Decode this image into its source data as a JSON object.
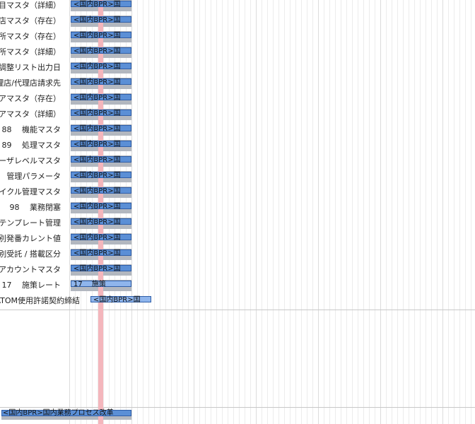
{
  "rows": [
    {
      "label": "目マスタ（詳細）",
      "bar": "<国内BPR>国"
    },
    {
      "label": "店マスタ（存在）",
      "bar": "<国内BPR>国"
    },
    {
      "label": "所マスタ（存在）",
      "bar": "<国内BPR>国"
    },
    {
      "label": "所マスタ（詳細）",
      "bar": "<国内BPR>国"
    },
    {
      "label": "調整リスト出力日",
      "bar": "<国内BPR>国"
    },
    {
      "label": "理店/代理店請求先",
      "bar": "<国内BPR>国"
    },
    {
      "label": "アマスタ（存在）",
      "bar": "<国内BPR>国"
    },
    {
      "label": "アマスタ（詳細）",
      "bar": "<国内BPR>国"
    },
    {
      "label": "88　 機能マスタ",
      "bar": "<国内BPR>国"
    },
    {
      "label": "89　 処理マスタ",
      "bar": "<国内BPR>国"
    },
    {
      "label": "ーザレベルマスタ",
      "bar": "<国内BPR>国"
    },
    {
      "label": "管理パラメータ",
      "bar": "<国内BPR>国"
    },
    {
      "label": "イクル管理マスタ",
      "bar": "<国内BPR>国"
    },
    {
      "label": "98　 業務閉塞",
      "bar": "<国内BPR>国"
    },
    {
      "label": "テンプレート管理",
      "bar": "<国内BPR>国"
    },
    {
      "label": "別発番カレント値",
      "bar": "<国内BPR>国"
    },
    {
      "label": "別受託 / 搭載区分",
      "bar": "<国内BPR>国"
    },
    {
      "label": "アカウントマスタ",
      "bar": "<国内BPR>国"
    },
    {
      "label": "17　 施策レート",
      "bar": "17　 施策",
      "light": true
    },
    {
      "label": "ATOM使用許諾契約締結",
      "bar": "<国内BPR>国",
      "wide": true
    }
  ],
  "bottom_bar": "<国内BPR>国内業務プロセス改革"
}
